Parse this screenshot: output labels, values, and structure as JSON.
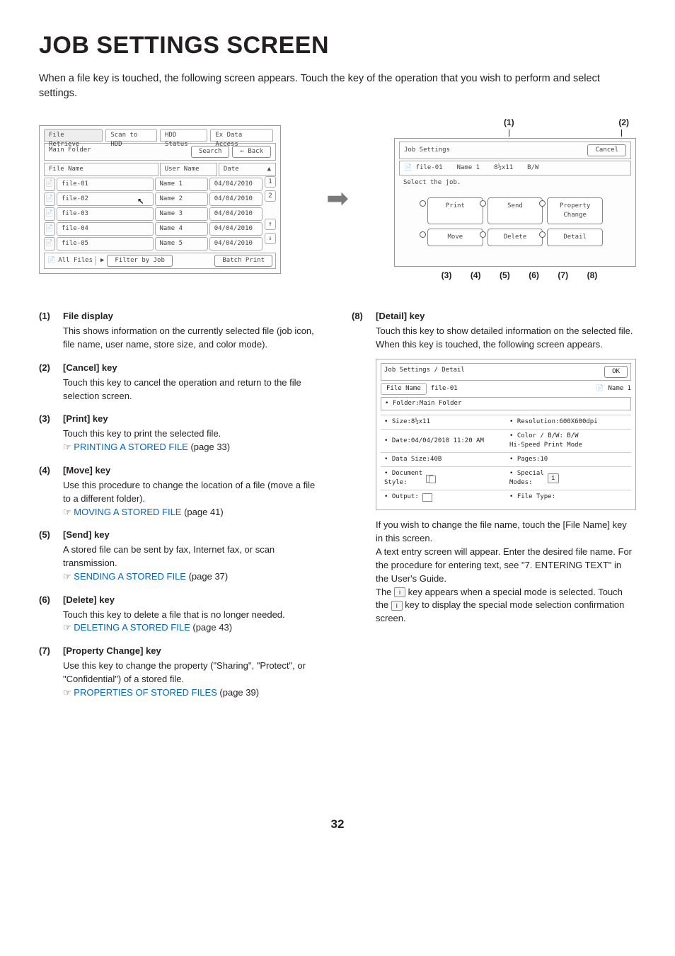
{
  "title": "JOB SETTINGS SCREEN",
  "intro": "When a file key is touched, the following screen appears. Touch the key of the operation that you wish to perform and select settings.",
  "figLeft": {
    "tabs": [
      "File Retrieve",
      "Scan to HDD",
      "HDD Status",
      "Ex Data Access"
    ],
    "mainFolder": "Main Folder",
    "search": "Search",
    "back": "Back",
    "cols": {
      "name": "File Name",
      "user": "User Name",
      "date": "Date"
    },
    "rows": [
      {
        "file": "file-01",
        "user": "Name 1",
        "date": "04/04/2010"
      },
      {
        "file": "file-02",
        "user": "Name 2",
        "date": "04/04/2010"
      },
      {
        "file": "file-03",
        "user": "Name 3",
        "date": "04/04/2010"
      },
      {
        "file": "file-04",
        "user": "Name 4",
        "date": "04/04/2010"
      },
      {
        "file": "file-05",
        "user": "Name 5",
        "date": "04/04/2010"
      }
    ],
    "allFiles": "All Files",
    "filter": "Filter by Job",
    "batch": "Batch Print"
  },
  "figRight": {
    "jobSettings": "Job Settings",
    "cancel": "Cancel",
    "fileLine": {
      "file": "file-01",
      "user": "Name 1",
      "size": "8½x11",
      "mode": "B/W"
    },
    "select": "Select the job.",
    "actions": [
      "Print",
      "Send",
      "Property\nChange",
      "Move",
      "Delete",
      "Detail"
    ],
    "topCallouts": [
      "(1)",
      "(2)"
    ],
    "bottomCallouts": [
      "(3)",
      "(4)",
      "(5)",
      "(6)",
      "(7)",
      "(8)"
    ]
  },
  "detail": {
    "header": "Job Settings / Detail",
    "ok": "OK",
    "fileNameLbl": "File Name",
    "file": "file-01",
    "user": "Name 1",
    "folder": "Folder:Main Folder",
    "rows": [
      [
        "Size:8½x11",
        "Resolution:600X600dpi"
      ],
      [
        "Date:04/04/2010 11:20 AM",
        "Color / B/W: B/W\nHi-Speed Print Mode"
      ],
      [
        "Data Size:40B",
        "Pages:10"
      ],
      [
        "Document\nStyle:",
        "Special\nModes:"
      ],
      [
        "Output:",
        "File Type:"
      ]
    ]
  },
  "items": [
    {
      "n": "(1)",
      "t": "File display",
      "b": "This shows information on the currently selected file (job icon, file name, user name, store size, and color mode)."
    },
    {
      "n": "(2)",
      "t": "[Cancel] key",
      "b": "Touch this key to cancel the operation and return to the file selection screen."
    },
    {
      "n": "(3)",
      "t": "[Print] key",
      "b": "Touch this key to print the selected file.",
      "ref": "PRINTING A STORED FILE",
      "pg": "(page 33)"
    },
    {
      "n": "(4)",
      "t": "[Move] key",
      "b": "Use this procedure to change the location of a file (move a file to a different folder).",
      "ref": "MOVING A STORED FILE",
      "pg": "(page 41)"
    },
    {
      "n": "(5)",
      "t": "[Send] key",
      "b": "A stored file can be sent by fax, Internet fax, or scan transmission.",
      "ref": "SENDING A STORED FILE",
      "pg": "(page 37)"
    },
    {
      "n": "(6)",
      "t": "[Delete] key",
      "b": "Touch this key to delete a file that is no longer needed.",
      "ref": "DELETING A STORED FILE",
      "pg": "(page 43)"
    },
    {
      "n": "(7)",
      "t": "[Property Change] key",
      "b": "Use this key to change the property (\"Sharing\", \"Protect\", or \"Confidential\") of a stored file.",
      "ref": "PROPERTIES OF STORED FILES",
      "pg": "(page 39)"
    }
  ],
  "item8": {
    "n": "(8)",
    "t": "[Detail] key",
    "b1": "Touch this key to show detailed information on the selected file.",
    "b2": "When this key is touched, the following screen appears.",
    "after1": "If you wish to change the file name, touch the [File Name] key in this screen.",
    "after2": "A text entry screen will appear. Enter the desired file name. For the procedure for entering text, see \"7. ENTERING TEXT\" in the User's Guide.",
    "after3a": "The ",
    "after3b": " key appears when a special mode is selected. Touch the ",
    "after3c": " key to display the special mode selection confirmation screen."
  },
  "pagenum": "32"
}
